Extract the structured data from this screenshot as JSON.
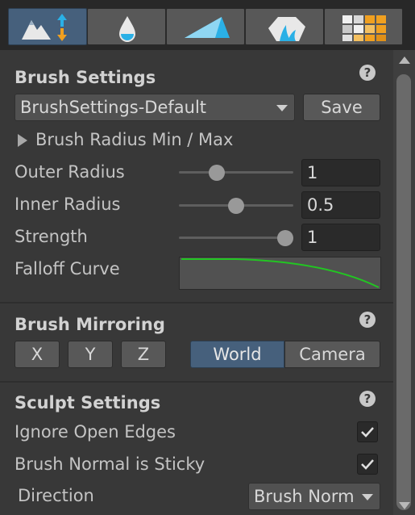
{
  "toolbar": {
    "tools": [
      {
        "icon": "terrain-raise-lower-icon",
        "active": true
      },
      {
        "icon": "water-drop-icon",
        "active": false
      },
      {
        "icon": "flatten-plane-icon",
        "active": false
      },
      {
        "icon": "smooth-rock-icon",
        "active": false
      },
      {
        "icon": "texture-tiles-icon",
        "active": false
      }
    ]
  },
  "brush_settings": {
    "title": "Brush Settings",
    "help": "?",
    "preset_value": "BrushSettings-Default",
    "save_label": "Save",
    "radius_foldout_label": "Brush Radius Min / Max",
    "outer_radius": {
      "label": "Outer Radius",
      "value": "1",
      "slider_fraction": 0.3
    },
    "inner_radius": {
      "label": "Inner Radius",
      "value": "0.5",
      "slider_fraction": 0.5
    },
    "strength": {
      "label": "Strength",
      "value": "1",
      "slider_fraction": 1.0
    },
    "falloff_label": "Falloff Curve",
    "falloff_color": "#22c522"
  },
  "brush_mirroring": {
    "title": "Brush Mirroring",
    "help": "?",
    "axes": [
      "X",
      "Y",
      "Z"
    ],
    "space_options": [
      "World",
      "Camera"
    ],
    "space_selected": "World"
  },
  "sculpt_settings": {
    "title": "Sculpt Settings",
    "help": "?",
    "ignore_open_edges": {
      "label": "Ignore Open Edges",
      "checked": true
    },
    "brush_normal_sticky": {
      "label": "Brush Normal is Sticky",
      "checked": true
    },
    "direction": {
      "label": "Direction",
      "value": "Brush Norm"
    }
  },
  "colors": {
    "active_blue": "#46607c",
    "panel_bg": "#3a3a3a",
    "accent_cyan": "#2ab0e6",
    "accent_orange": "#f0a020"
  }
}
